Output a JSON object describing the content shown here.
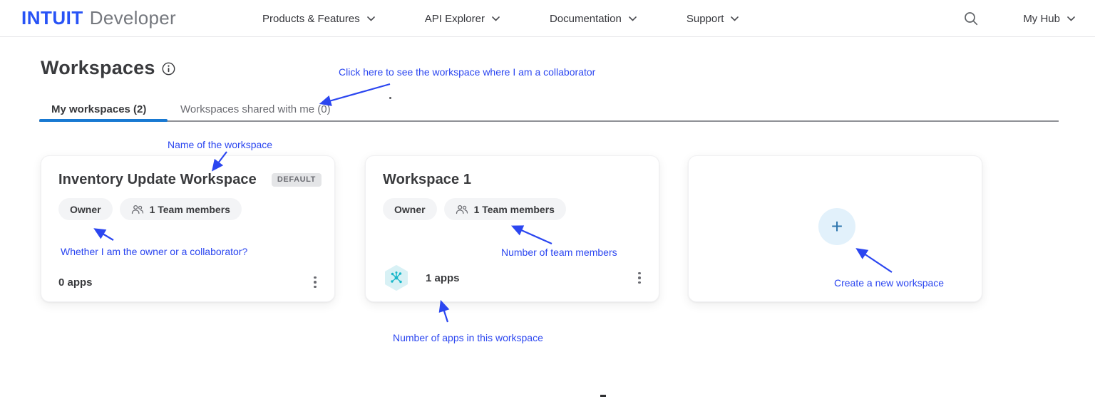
{
  "header": {
    "logo_primary": "INTUIT",
    "logo_secondary": "Developer",
    "nav_items": [
      {
        "label": "Products & Features"
      },
      {
        "label": "API Explorer"
      },
      {
        "label": "Documentation"
      },
      {
        "label": "Support"
      }
    ],
    "search_icon": "search-icon",
    "account_menu": "My Hub"
  },
  "page": {
    "title": "Workspaces",
    "info_icon": "info-icon"
  },
  "tabs": {
    "my_workspaces": "My workspaces (2)",
    "shared_with_me": "Workspaces shared with me (0)"
  },
  "cards": [
    {
      "title": "Inventory Update Workspace",
      "badge": "DEFAULT",
      "role": "Owner",
      "team": "1 Team members",
      "apps": "0 apps"
    },
    {
      "title": "Workspace 1",
      "role": "Owner",
      "team": "1 Team members",
      "apps": "1 apps"
    },
    {
      "plus": "+"
    }
  ],
  "annotations": {
    "shared_tab": "Click here to see the workspace where I am a collaborator",
    "workspace_name": "Name of the workspace",
    "owner_role": "Whether I am the owner or a collaborator?",
    "team_members": "Number of team members",
    "apps_count": "Number of apps in this workspace",
    "create_workspace": "Create a new workspace"
  },
  "colors": {
    "annotation_blue": "#2b46f0",
    "logo_blue": "#2853f6",
    "active_tab_blue": "#1879d2",
    "app_icon_teal": "#19b7c9",
    "plus_circle_bg": "#e2f1fb"
  }
}
